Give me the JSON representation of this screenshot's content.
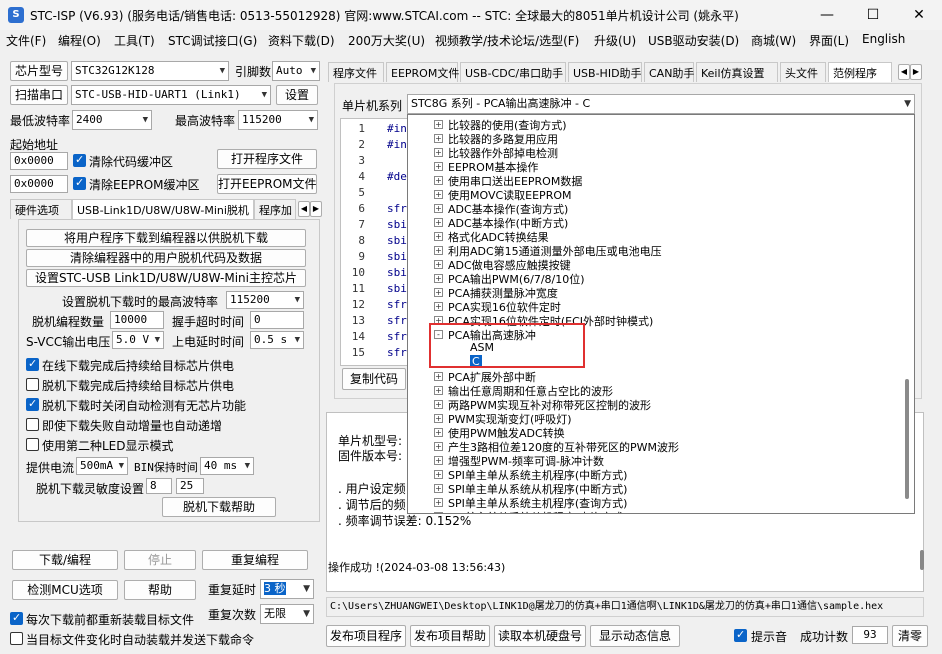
{
  "title": {
    "text": "STC-ISP (V6.93) (服务电话/销售电话: 0513-55012928) 官网:www.STCAI.com  -- STC: 全球最大的8051单片机设计公司 (姚永平)"
  },
  "window_controls": {
    "minimize": "—",
    "maximize": "☐",
    "close": "✕"
  },
  "menu": [
    "文件(F)",
    "编程(O)",
    "工具(T)",
    "STC调试接口(G)",
    "资料下载(D)",
    "200万大奖(U)",
    "视频教学/技术论坛/选型(F)",
    "升级(U)",
    "USB驱动安装(D)",
    "商城(W)",
    "界面(L)",
    "English"
  ],
  "left": {
    "chip_label": "芯片型号",
    "chip_value": "STC32G12K128",
    "pins_label": "引脚数",
    "pins_value": "Auto",
    "scan_button": "扫描串口",
    "port_value": "STC-USB-HID-UART1 (Link1)",
    "settings_button": "设置",
    "min_baud_label": "最低波特率",
    "min_baud_value": "2400",
    "max_baud_label": "最高波特率",
    "max_baud_value": "115200",
    "start_addr_label": "起始地址",
    "addr1": "0x0000",
    "clear_code_label": "清除代码缓冲区",
    "open_prog_button": "打开程序文件",
    "addr2": "0x0000",
    "clear_eeprom_label": "清除EEPROM缓冲区",
    "open_eeprom_button": "打开EEPROM文件",
    "tabs": [
      "硬件选项",
      "USB-Link1D/U8W/U8W-Mini脱机",
      "程序加"
    ],
    "offline": {
      "btn_download_offline": "将用户程序下载到编程器以供脱机下载",
      "btn_clear_offline": "清除编程器中的用户脱机代码及数据",
      "btn_set_master": "设置STC-USB Link1D/U8W/U8W-Mini主控芯片",
      "max_baud_label": "设置脱机下载时的最高波特率",
      "max_baud_value": "115200",
      "count_label": "脱机编程数量",
      "count_value": "10000",
      "timeout_label": "握手超时时间",
      "timeout_value": "0",
      "svcc_label": "S-VCC输出电压",
      "svcc_value": "5.0 V",
      "delay_label": "上电延时时间",
      "delay_value": "0.5 s",
      "checks": [
        {
          "label": "在线下载完成后持续给目标芯片供电",
          "checked": true
        },
        {
          "label": "脱机下载完成后持续给目标芯片供电",
          "checked": false
        },
        {
          "label": "脱机下载时关闭自动检测有无芯片功能",
          "checked": true
        },
        {
          "label": "即使下载失败自动增量也自动递增",
          "checked": false
        },
        {
          "label": "使用第二种LED显示模式",
          "checked": false
        }
      ],
      "current_label": "提供电流",
      "current_value": "500mA",
      "bin_label": "BIN保持时间",
      "bin_value": "40 ms",
      "sens_label": "脱机下载灵敏度设置",
      "sens_v1": "8",
      "sens_v2": "25",
      "help_button": "脱机下载帮助"
    },
    "bottom": {
      "download_button": "下载/编程",
      "stop_button": "停止",
      "reprogram_button": "重复编程",
      "check_mcu_button": "检测MCU选项",
      "help_button": "帮助",
      "repeat_delay_label": "重复延时",
      "repeat_delay_value": "3 秒",
      "repeat_count_label": "重复次数",
      "repeat_count_value": "无限",
      "reload_label": "每次下载前都重新装载目标文件",
      "reload_checked": true,
      "auto_label": "当目标文件变化时自动装载并发送下载命令",
      "auto_checked": false
    }
  },
  "right": {
    "tabs": [
      "程序文件",
      "EEPROM文件",
      "USB-CDC/串口助手",
      "USB-HID助手",
      "CAN助手",
      "Keil仿真设置",
      "头文件",
      "范例程序"
    ],
    "mcu_series_label": "单片机系列",
    "mcu_series_value": "STC8G 系列 - PCA输出高速脉冲 - C",
    "code_lines": [
      {
        "num": "1",
        "text": "#inc"
      },
      {
        "num": "2",
        "text": "#inc"
      },
      {
        "num": "3",
        "text": ""
      },
      {
        "num": "4",
        "text": "#def"
      },
      {
        "num": "5",
        "text": ""
      },
      {
        "num": "6",
        "text": "sfr"
      },
      {
        "num": "7",
        "text": "sbit"
      },
      {
        "num": "8",
        "text": "sbit"
      },
      {
        "num": "9",
        "text": "sbit"
      },
      {
        "num": "10",
        "text": "sbit"
      },
      {
        "num": "11",
        "text": "sbit"
      },
      {
        "num": "12",
        "text": "sfr"
      },
      {
        "num": "13",
        "text": "sfr"
      },
      {
        "num": "14",
        "text": "sfr"
      },
      {
        "num": "15",
        "text": "sfr"
      }
    ],
    "copy_code_button": "复制代码",
    "tree": [
      {
        "label": "比较器的使用(查询方式)",
        "exp": "+"
      },
      {
        "label": "比较器的多路复用应用",
        "exp": "+"
      },
      {
        "label": "比较器作外部掉电检测",
        "exp": "+"
      },
      {
        "label": "EEPROM基本操作",
        "exp": "+"
      },
      {
        "label": "使用串口送出EEPROM数据",
        "exp": "+"
      },
      {
        "label": "使用MOVC读取EEPROM",
        "exp": "+"
      },
      {
        "label": "ADC基本操作(查询方式)",
        "exp": "+"
      },
      {
        "label": "ADC基本操作(中断方式)",
        "exp": "+"
      },
      {
        "label": "格式化ADC转换结果",
        "exp": "+"
      },
      {
        "label": "利用ADC第15通道测量外部电压或电池电压",
        "exp": "+"
      },
      {
        "label": "ADC做电容感应触摸按键",
        "exp": "+"
      },
      {
        "label": "PCA输出PWM(6/7/8/10位)",
        "exp": "+"
      },
      {
        "label": "PCA捕获测量脉冲宽度",
        "exp": "+"
      },
      {
        "label": "PCA实现16位软件定时",
        "exp": "+"
      },
      {
        "label": "PCA实现16位软件定时(ECI外部时钟模式)",
        "exp": "+"
      },
      {
        "label": "PCA输出高速脉冲",
        "exp": "-"
      },
      {
        "label": "ASM",
        "exp": "",
        "child": true
      },
      {
        "label": "C",
        "exp": "",
        "child": true,
        "selected": true
      },
      {
        "label": "PCA扩展外部中断",
        "exp": "+"
      },
      {
        "label": "输出任意周期和任意占空比的波形",
        "exp": "+"
      },
      {
        "label": "两路PWM实现互补对称带死区控制的波形",
        "exp": "+"
      },
      {
        "label": "PWM实现渐变灯(呼吸灯)",
        "exp": "+"
      },
      {
        "label": "使用PWM触发ADC转换",
        "exp": "+"
      },
      {
        "label": "产生3路相位差120度的互补带死区的PWM波形",
        "exp": "+"
      },
      {
        "label": "增强型PWM-频率可调-脉冲计数",
        "exp": "+"
      },
      {
        "label": "SPI单主单从系统主机程序(中断方式)",
        "exp": "+"
      },
      {
        "label": "SPI单主单从系统从机程序(中断方式)",
        "exp": "+"
      },
      {
        "label": "SPI单主单从系统主机程序(查询方式)",
        "exp": "+"
      },
      {
        "label": "SPI单主单从系统从机程序(查询方式)",
        "exp": "+"
      }
    ],
    "info": {
      "line1": "单片机型号:",
      "line2": "固件版本号:",
      "line3": ". 用户设定频",
      "line4": ". 调节后的频",
      "line5": ". 频率调节误差: 0.152%"
    },
    "log": "操作成功 !(2024-03-08 13:56:43)",
    "path": "C:\\Users\\ZHUANGWEI\\Desktop\\LINK1D@屠龙刀的仿真+串口1通信啊\\LINK1D&屠龙刀的仿真+串口1通信\\sample.hex",
    "bottom": {
      "publish_prog": "发布项目程序",
      "publish_help": "发布项目帮助",
      "read_disk": "读取本机硬盘号",
      "show_dynamic": "显示动态信息",
      "beep_label": "提示音",
      "beep_checked": true,
      "count_label": "成功计数",
      "count_value": "93",
      "clear_button": "清零"
    }
  },
  "accent": "#0a64c8",
  "highlight_box": "#e03030"
}
